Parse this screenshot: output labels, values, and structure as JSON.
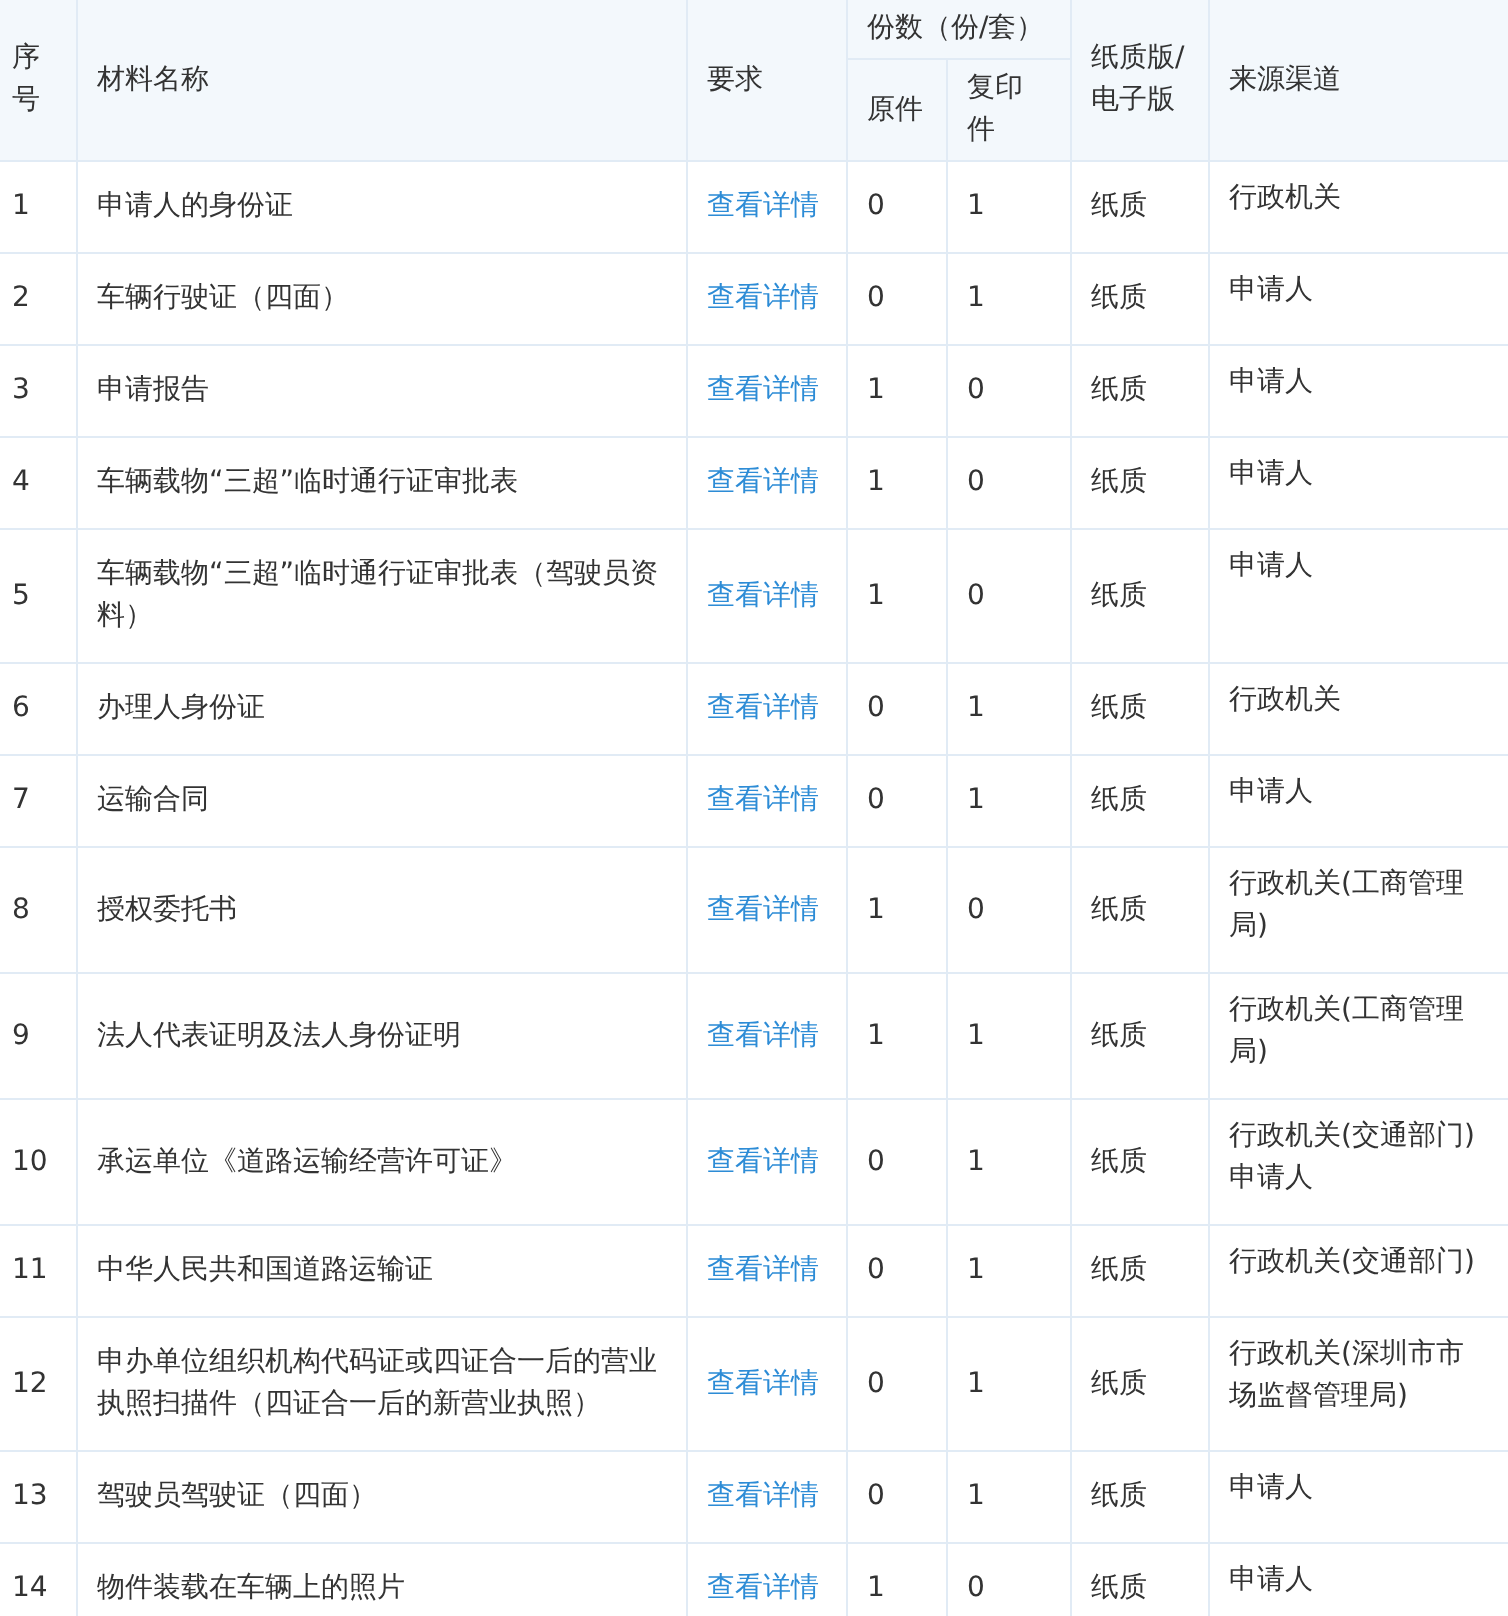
{
  "table": {
    "header": {
      "index": "序号",
      "name": "材料名称",
      "requirement": "要求",
      "copies_group": "份数（份/套）",
      "original": "原件",
      "copy": "复印件",
      "format": "纸质版/电子版",
      "source": "来源渠道"
    },
    "rows": [
      {
        "index": "1",
        "name": "申请人的身份证",
        "requirement": "查看详情",
        "original": "0",
        "copy": "1",
        "format": "纸质",
        "source": [
          "行政机关"
        ]
      },
      {
        "index": "2",
        "name": "车辆行驶证（四面）",
        "requirement": "查看详情",
        "original": "0",
        "copy": "1",
        "format": "纸质",
        "source": [
          "申请人"
        ]
      },
      {
        "index": "3",
        "name": "申请报告",
        "requirement": "查看详情",
        "original": "1",
        "copy": "0",
        "format": "纸质",
        "source": [
          "申请人"
        ]
      },
      {
        "index": "4",
        "name": "车辆载物“三超”临时通行证审批表",
        "requirement": "查看详情",
        "original": "1",
        "copy": "0",
        "format": "纸质",
        "source": [
          "申请人"
        ]
      },
      {
        "index": "5",
        "name": "车辆载物“三超”临时通行证审批表（驾驶员资料）",
        "requirement": "查看详情",
        "original": "1",
        "copy": "0",
        "format": "纸质",
        "source": [
          "申请人"
        ]
      },
      {
        "index": "6",
        "name": "办理人身份证",
        "requirement": "查看详情",
        "original": "0",
        "copy": "1",
        "format": "纸质",
        "source": [
          "行政机关"
        ]
      },
      {
        "index": "7",
        "name": "运输合同",
        "requirement": "查看详情",
        "original": "0",
        "copy": "1",
        "format": "纸质",
        "source": [
          "申请人"
        ]
      },
      {
        "index": "8",
        "name": "授权委托书",
        "requirement": "查看详情",
        "original": "1",
        "copy": "0",
        "format": "纸质",
        "source": [
          "行政机关(工商管理局)"
        ]
      },
      {
        "index": "9",
        "name": "法人代表证明及法人身份证明",
        "requirement": "查看详情",
        "original": "1",
        "copy": "1",
        "format": "纸质",
        "source": [
          "行政机关(工商管理局)"
        ]
      },
      {
        "index": "10",
        "name": "承运单位《道路运输经营许可证》",
        "requirement": "查看详情",
        "original": "0",
        "copy": "1",
        "format": "纸质",
        "source": [
          "行政机关(交通部门)",
          "申请人"
        ]
      },
      {
        "index": "11",
        "name": "中华人民共和国道路运输证",
        "requirement": "查看详情",
        "original": "0",
        "copy": "1",
        "format": "纸质",
        "source": [
          "行政机关(交通部门)"
        ]
      },
      {
        "index": "12",
        "name": "申办单位组织机构代码证或四证合一后的营业执照扫描件（四证合一后的新营业执照）",
        "requirement": "查看详情",
        "original": "0",
        "copy": "1",
        "format": "纸质",
        "source": [
          "行政机关(深圳市市场监督管理局)"
        ]
      },
      {
        "index": "13",
        "name": "驾驶员驾驶证（四面）",
        "requirement": "查看详情",
        "original": "0",
        "copy": "1",
        "format": "纸质",
        "source": [
          "申请人"
        ]
      },
      {
        "index": "14",
        "name": "物件装载在车辆上的照片",
        "requirement": "查看详情",
        "original": "1",
        "copy": "0",
        "format": "纸质",
        "source": [
          "申请人"
        ]
      }
    ]
  }
}
